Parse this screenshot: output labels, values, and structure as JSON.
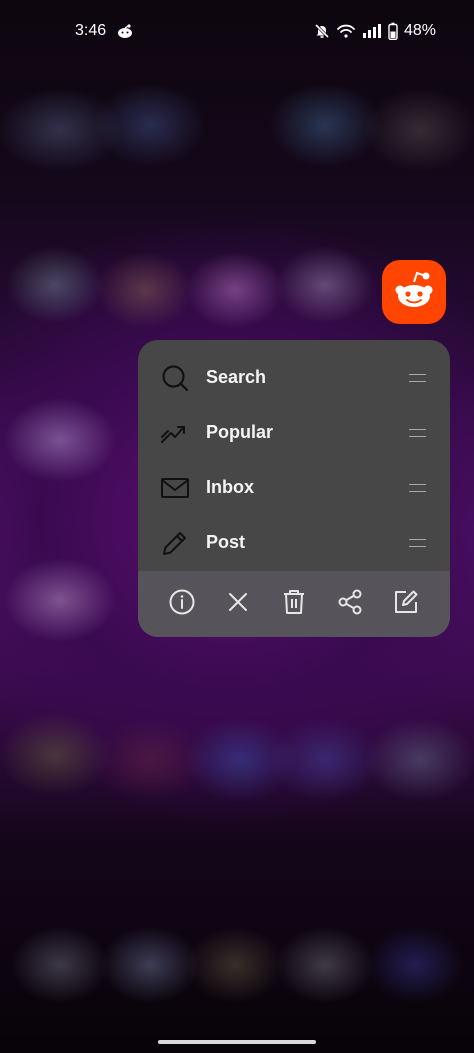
{
  "status_bar": {
    "time": "3:46",
    "battery": "48%",
    "icons": [
      "reddit-notification-icon",
      "mute-icon",
      "wifi-icon",
      "signal-icon",
      "battery-icon"
    ]
  },
  "app": {
    "icon": "reddit-icon",
    "brand_color": "#ff4500"
  },
  "shortcuts": [
    {
      "label": "Search",
      "icon": "search-icon"
    },
    {
      "label": "Popular",
      "icon": "trending-icon"
    },
    {
      "label": "Inbox",
      "icon": "mail-icon"
    },
    {
      "label": "Post",
      "icon": "pencil-icon"
    }
  ],
  "actions": [
    {
      "icon": "info-icon"
    },
    {
      "icon": "close-icon"
    },
    {
      "icon": "trash-icon"
    },
    {
      "icon": "share-icon"
    },
    {
      "icon": "edit-icon"
    }
  ]
}
